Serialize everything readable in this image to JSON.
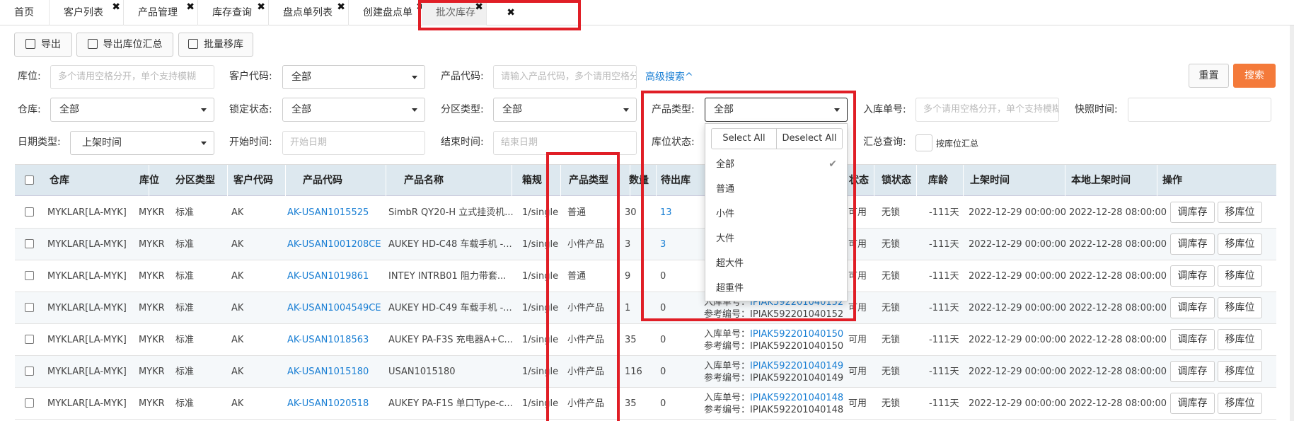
{
  "tabs": [
    {
      "label": "首页",
      "close": false
    },
    {
      "label": "客户列表",
      "close": true
    },
    {
      "label": "产品管理",
      "close": true
    },
    {
      "label": "库存查询",
      "close": true
    },
    {
      "label": "盘点单列表",
      "close": true
    },
    {
      "label": "创建盘点单",
      "close": true
    },
    {
      "label": "批次库存",
      "close": true
    },
    {
      "label": "",
      "close": true
    }
  ],
  "toolbar": {
    "export": "导出",
    "export_summary": "导出库位汇总",
    "batch_move": "批量移库"
  },
  "filters": {
    "location_label": "库位:",
    "location_placeholder": "多个请用空格分开，单个支持模糊",
    "customer_code_label": "客户代码:",
    "customer_code_value": "全部",
    "product_code_label": "产品代码:",
    "product_code_placeholder": "请输入产品代码，多个请用空格分开",
    "advanced_search": "高级搜索^",
    "reset": "重置",
    "search": "搜索",
    "warehouse_label": "仓库:",
    "warehouse_value": "全部",
    "lock_status_label": "锁定状态:",
    "lock_status_value": "全部",
    "zone_type_label": "分区类型:",
    "zone_type_value": "全部",
    "product_type_label": "产品类型:",
    "product_type_value": "全部",
    "inbound_no_label": "入库单号:",
    "inbound_no_placeholder": "多个请用空格分开，单个支持模糊",
    "snapshot_time_label": "快照时间:",
    "date_type_label": "日期类型:",
    "date_type_value": "上架时间",
    "start_time_label": "开始时间:",
    "start_time_placeholder": "开始日期",
    "end_time_label": "结束时间:",
    "end_time_placeholder": "结束日期",
    "location_status_label": "库位状态:",
    "summary_query_label": "汇总查询:",
    "summary_by_location": "按库位汇总"
  },
  "dropdown": {
    "select_all": "Select All",
    "deselect_all": "Deselect All",
    "options": [
      "全部",
      "普通",
      "小件",
      "大件",
      "超大件",
      "超重件"
    ],
    "selected": "全部"
  },
  "table": {
    "headers": [
      "仓库",
      "库位",
      "分区类型",
      "客户代码",
      "产品代码",
      "产品名称",
      "箱规",
      "产品类型",
      "数量",
      "待出库",
      "",
      "状态",
      "锁状态",
      "库龄",
      "上架时间",
      "本地上架时间",
      "操作"
    ],
    "rows": [
      {
        "wh": "MYKLAR[LA-MYK]",
        "loc": "MYKR",
        "zone": "标准",
        "cust": "AK",
        "code": "AK-USAN1015525",
        "name": "SimbR QY20-H 立式挂烫机...",
        "box": "1/single",
        "ptype": "普通",
        "qty": "30",
        "pending": "13",
        "inbound_label": "",
        "inbound_no": "",
        "ref_label": "",
        "ref_no": "",
        "status": "可用",
        "lock": "无锁",
        "age": "-111天",
        "shelf": "2022-12-29 00:00:00",
        "local": "2022-12-28 08:00:00"
      },
      {
        "wh": "MYKLAR[LA-MYK]",
        "loc": "MYKR",
        "zone": "标准",
        "cust": "AK",
        "code": "AK-USAN1001208CE",
        "name": "AUKEY HD-C48 车载手机 -...",
        "box": "1/single",
        "ptype": "小件产品",
        "qty": "3",
        "pending": "3",
        "inbound_label": "",
        "inbound_no": "",
        "ref_label": "",
        "ref_no": "",
        "status": "可用",
        "lock": "无锁",
        "age": "-111天",
        "shelf": "2022-12-29 00:00:00",
        "local": "2022-12-28 08:00:00"
      },
      {
        "wh": "MYKLAR[LA-MYK]",
        "loc": "MYKR",
        "zone": "标准",
        "cust": "AK",
        "code": "AK-USAN1019861",
        "name": "INTEY INTRB01 阻力带套...",
        "box": "1/single",
        "ptype": "普通",
        "qty": "9",
        "pending": "0",
        "inbound_label": "",
        "inbound_no": "",
        "ref_label": "",
        "ref_no": "",
        "status": "可用",
        "lock": "无锁",
        "age": "-111天",
        "shelf": "2022-12-29 00:00:00",
        "local": "2022-12-28 08:00:00"
      },
      {
        "wh": "MYKLAR[LA-MYK]",
        "loc": "MYKR",
        "zone": "标准",
        "cust": "AK",
        "code": "AK-USAN1004549CE",
        "name": "AUKEY HD-C49 车载手机 -...",
        "box": "1/single",
        "ptype": "小件产品",
        "qty": "1",
        "pending": "0",
        "inbound_label": "入库单号：",
        "inbound_no": "IPIAK592201040152",
        "ref_label": "参考编号：",
        "ref_no": "IPIAK592201040152",
        "status": "可用",
        "lock": "无锁",
        "age": "-111天",
        "shelf": "2022-12-29 00:00:00",
        "local": "2022-12-28 08:00:00"
      },
      {
        "wh": "MYKLAR[LA-MYK]",
        "loc": "MYKR",
        "zone": "标准",
        "cust": "AK",
        "code": "AK-USAN1018563",
        "name": "AUKEY PA-F3S 充电器A+C...",
        "box": "1/single",
        "ptype": "小件产品",
        "qty": "35",
        "pending": "0",
        "inbound_label": "入库单号：",
        "inbound_no": "IPIAK592201040150",
        "ref_label": "参考编号：",
        "ref_no": "IPIAK592201040150",
        "status": "可用",
        "lock": "无锁",
        "age": "-111天",
        "shelf": "2022-12-29 00:00:00",
        "local": "2022-12-28 08:00:00"
      },
      {
        "wh": "MYKLAR[LA-MYK]",
        "loc": "MYKR",
        "zone": "标准",
        "cust": "AK",
        "code": "AK-USAN1015180",
        "name": "USAN1015180",
        "box": "1/single",
        "ptype": "小件产品",
        "qty": "116",
        "pending": "0",
        "inbound_label": "入库单号：",
        "inbound_no": "IPIAK592201040149",
        "ref_label": "参考编号：",
        "ref_no": "IPIAK592201040149",
        "status": "可用",
        "lock": "无锁",
        "age": "-111天",
        "shelf": "2022-12-29 00:00:00",
        "local": "2022-12-28 08:00:00"
      },
      {
        "wh": "MYKLAR[LA-MYK]",
        "loc": "MYKR",
        "zone": "标准",
        "cust": "AK",
        "code": "AK-USAN1020518",
        "name": "AUKEY PA-F1S 单口Type-c...",
        "box": "1/single",
        "ptype": "小件产品",
        "qty": "35",
        "pending": "0",
        "inbound_label": "入库单号：",
        "inbound_no": "IPIAK592201040148",
        "ref_label": "参考编号：",
        "ref_no": "IPIAK592201040148",
        "status": "可用",
        "lock": "无锁",
        "age": "-111天",
        "shelf": "2022-12-29 00:00:00",
        "local": "2022-12-28 08:00:00"
      }
    ],
    "action_adjust": "调库存",
    "action_move": "移库位"
  }
}
